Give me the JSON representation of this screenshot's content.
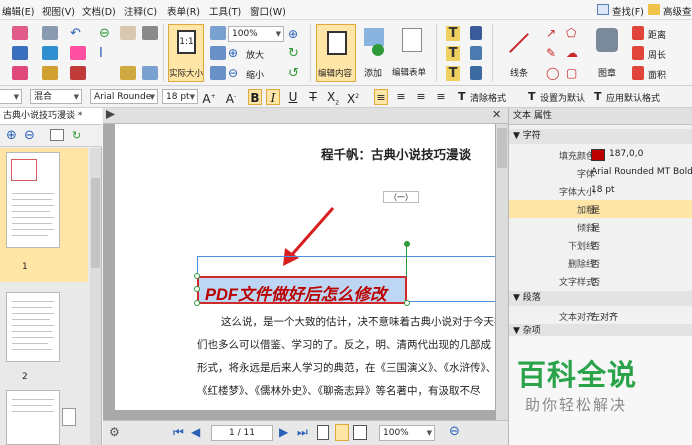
{
  "menubar": {
    "items": [
      "编辑(E)",
      "视图(V)",
      "文档(D)",
      "注释(C)",
      "表单(R)",
      "工具(T)",
      "窗口(W)"
    ],
    "right": [
      "查找(F)",
      "高级查"
    ]
  },
  "ribbon": {
    "zoom_value": "100%",
    "zoom_in": "放大",
    "zoom_out": "缩小",
    "actual_size": "实际大小",
    "edit_content": "编辑内容",
    "add": "添加",
    "edit_form": "编辑表单",
    "line": "线条",
    "stamp": "图章",
    "distance": "距离",
    "perimeter": "周长",
    "area": "面积"
  },
  "format_bar": {
    "blend": "混合",
    "font": "Arial Rounde",
    "size": "18 pt",
    "clear_format": "清除格式",
    "set_default": "设置为默认",
    "apply_default": "应用默认格式"
  },
  "doc_tab": {
    "title": "古典小说技巧漫谈 *"
  },
  "thumbnails": {
    "pages": [
      "1",
      "2"
    ]
  },
  "document": {
    "title": "程千帆：古典小说技巧漫谈",
    "subtitle": "（一）",
    "selected_text": "PDF文件做好后怎么修改",
    "body_lines": [
      "这么说，是一个大致的估计，决不意味着古典小说对于今天在",
      "们也多么可以借鉴、学习的了。反之，明、清两代出现的几部成",
      "形式，将永远是后来人学习的典范，在《三国演义》、《水浒传》、",
      "《红楼梦》、《儒林外史》、《聊斋志异》等名著中，有汲取不尽"
    ]
  },
  "status": {
    "page_field": "1 / 11",
    "zoom": "100%"
  },
  "properties": {
    "panel_title": "文本 属性",
    "section_char": "字符",
    "rows": [
      {
        "key": "填充颜色",
        "value": "187,0,0"
      },
      {
        "key": "字体",
        "value": "Arial Rounded MT Bold"
      },
      {
        "key": "字体大小",
        "value": "18 pt"
      },
      {
        "key": "加粗",
        "value": "是"
      },
      {
        "key": "倾斜",
        "value": "是"
      },
      {
        "key": "下划线",
        "value": "否"
      },
      {
        "key": "删除线",
        "value": "否"
      },
      {
        "key": "文字样式",
        "value": "否"
      }
    ],
    "section_para": "段落",
    "align_key": "文本对齐",
    "align_value": "左对齐",
    "section_misc": "杂项"
  },
  "watermark": {
    "title": "百科全说",
    "subtitle": "助你轻松解决"
  },
  "colors": {
    "fill": "#bb0000",
    "accent": "#ffe6a6",
    "watermark": "#2aa34a"
  }
}
